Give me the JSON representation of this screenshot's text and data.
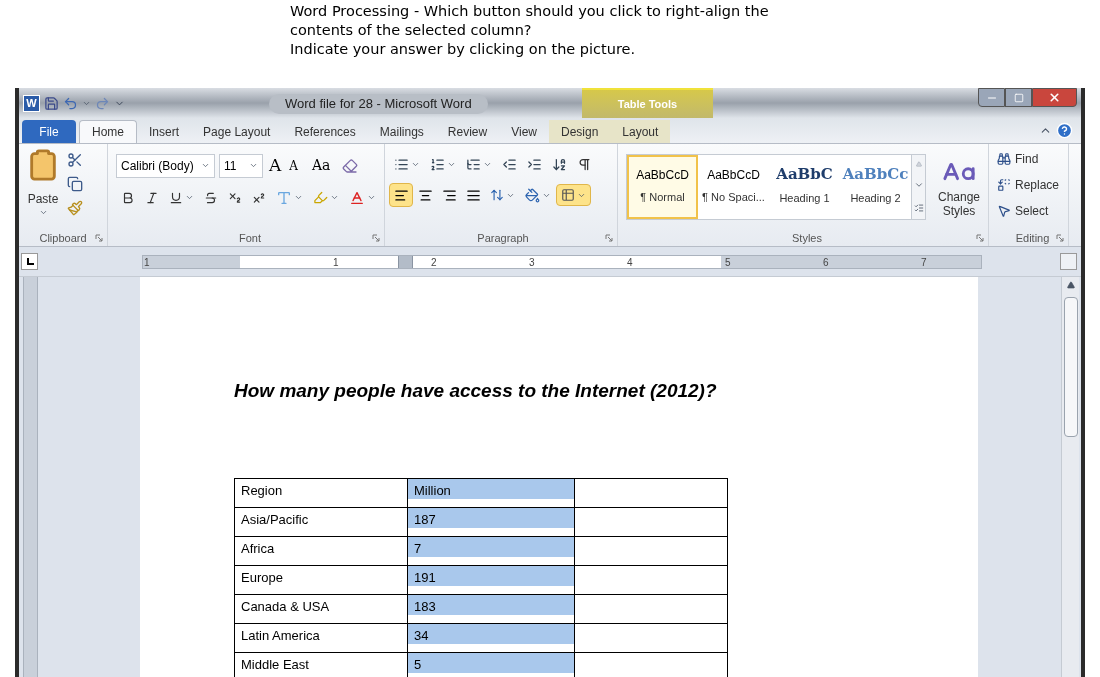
{
  "question": {
    "lines": [
      "Word Processing - Which button should you click to right-align the",
      "contents of the selected column?",
      "Indicate your answer by clicking on the picture."
    ]
  },
  "window": {
    "logo": "W",
    "title": "Word file for 28  -  Microsoft Word",
    "contextual_group": "Table Tools"
  },
  "tabs": [
    {
      "label": "File",
      "kind": "file",
      "selected": false
    },
    {
      "label": "Home",
      "kind": "tab",
      "selected": true
    },
    {
      "label": "Insert",
      "kind": "tab",
      "selected": false
    },
    {
      "label": "Page Layout",
      "kind": "tab",
      "selected": false
    },
    {
      "label": "References",
      "kind": "tab",
      "selected": false
    },
    {
      "label": "Mailings",
      "kind": "tab",
      "selected": false
    },
    {
      "label": "Review",
      "kind": "tab",
      "selected": false
    },
    {
      "label": "View",
      "kind": "tab",
      "selected": false
    },
    {
      "label": "Design",
      "kind": "contextual",
      "selected": false
    },
    {
      "label": "Layout",
      "kind": "contextual",
      "selected": false
    }
  ],
  "ribbon": {
    "clipboard": {
      "paste": "Paste",
      "label": "Clipboard"
    },
    "font": {
      "family": "Calibri (Body)",
      "size": "11",
      "grow": "A",
      "shrink": "A",
      "case": "Aa",
      "label": "Font"
    },
    "paragraph": {
      "alignment": [
        {
          "kind": "left",
          "selected": true
        },
        {
          "kind": "center",
          "selected": false
        },
        {
          "kind": "right",
          "selected": false
        },
        {
          "kind": "justify",
          "selected": false
        }
      ],
      "borders_active": true,
      "label": "Paragraph"
    },
    "styles": {
      "items": [
        {
          "preview": "AaBbCcD",
          "label": "¶ Normal",
          "kind": "body",
          "selected": true
        },
        {
          "preview": "AaBbCcD",
          "label": "¶ No Spaci...",
          "kind": "body",
          "selected": false
        },
        {
          "preview": "AaBbC",
          "label": "Heading 1",
          "kind": "heading1",
          "selected": false
        },
        {
          "preview": "AaBbCc",
          "label": "Heading 2",
          "kind": "heading2",
          "selected": false
        }
      ],
      "change_styles": "Change Styles",
      "label": "Styles"
    },
    "editing": {
      "items": [
        {
          "kind": "find",
          "label": "Find"
        },
        {
          "kind": "replace",
          "label": "Replace"
        },
        {
          "kind": "select",
          "label": "Select"
        }
      ],
      "label": "Editing"
    }
  },
  "ruler": {
    "numbers": [
      "1",
      "1",
      "2",
      "3",
      "4",
      "5",
      "6",
      "7"
    ]
  },
  "document": {
    "heading": "How many people have access to the Internet (2012)?",
    "table": {
      "columns": [
        {
          "selected": false
        },
        {
          "selected": true
        },
        {
          "selected": false
        }
      ],
      "rows": [
        [
          "Region",
          "Million"
        ],
        [
          "Asia/Pacific",
          "187"
        ],
        [
          "Africa",
          "7"
        ],
        [
          "Europe",
          "191"
        ],
        [
          "Canada & USA",
          "183"
        ],
        [
          "Latin America",
          "34"
        ],
        [
          "Middle East",
          "5"
        ]
      ]
    }
  }
}
